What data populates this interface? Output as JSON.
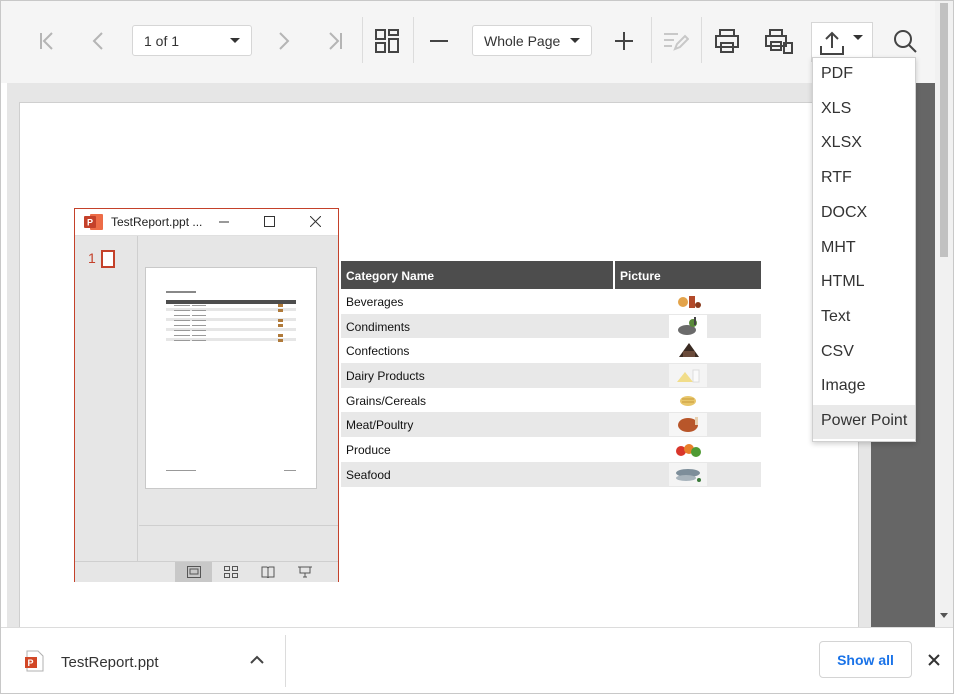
{
  "toolbar": {
    "page_selector": "1 of 1",
    "zoom_selector": "Whole Page"
  },
  "export_menu": {
    "items": [
      "PDF",
      "XLS",
      "XLSX",
      "RTF",
      "DOCX",
      "MHT",
      "HTML",
      "Text",
      "CSV",
      "Image",
      "Power Point"
    ],
    "highlighted": "Power Point"
  },
  "report": {
    "columns": [
      "Category Name",
      "Picture"
    ],
    "rows": [
      "Beverages",
      "Condiments",
      "Confections",
      "Dairy Products",
      "Grains/Cereals",
      "Meat/Poultry",
      "Produce",
      "Seafood"
    ]
  },
  "ppt_window": {
    "title": "TestReport.ppt ...",
    "slide_number": "1"
  },
  "download_bar": {
    "file_name": "TestReport.ppt",
    "show_all_label": "Show all"
  },
  "colors": {
    "accent_red": "#c4412a",
    "header_bg": "#4d4d4d",
    "link_blue": "#1a73e8"
  }
}
